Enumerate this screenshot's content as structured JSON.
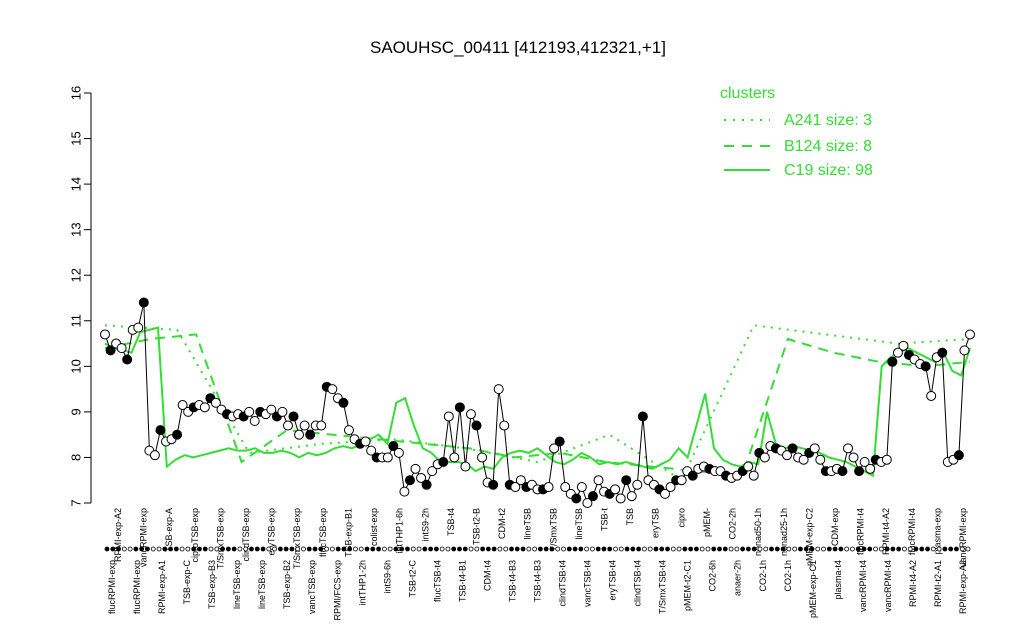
{
  "chart_data": {
    "type": "line",
    "title": "SAOUHSC_00411 [412193,412321,+1]",
    "ylim": [
      7,
      16
    ],
    "yticks": [
      7,
      8,
      9,
      10,
      11,
      12,
      13,
      14,
      15,
      16
    ],
    "legend": {
      "title": "clusters",
      "placement": "top-right",
      "color": "#33dd33",
      "entries": [
        {
          "label": "A241 size: 3",
          "style": "dotted"
        },
        {
          "label": "B124 size: 8",
          "style": "dashed"
        },
        {
          "label": "C19 size: 98",
          "style": "solid"
        }
      ]
    },
    "bottom_labels": [
      "flucRPMI-exp",
      "flucRPMI-exp",
      "RPMI-exp-A1",
      "TSB-exp-C",
      "TSB-exp-B3",
      "lineTSB-exp",
      "lineTSB-exp",
      "TSB-exp-B2",
      "vancTSB-exp",
      "RPMI/FCS-exp",
      "intTHP1-2h",
      "intS9-6h",
      "TSB-t2-C",
      "flucTSB-t4",
      "TSB-t4-B1",
      "CDM-t4",
      "TSB-t4-B3",
      "TSB-t4-B3",
      "clindTSB-t4",
      "vancTSB-t4",
      "eryTSB-t4",
      "clindTSB-t4",
      "T/SmxTSB-t4",
      "pMEM-t2-C1",
      "CO2-6h",
      "anaer-2h",
      "CO2-1h",
      "CO2-1h",
      "pMEM-exp-C1",
      "plasma-t4",
      "vancRPMI-t4",
      "vancRPMI-t4",
      "RPMI-t4-A2",
      "RPMI-t2-A1",
      "RPMI-exp-A2"
    ],
    "top_labels": [
      "RPMI-exp-A2",
      "vancRPMI-exp",
      "TSB-exp-A",
      "ciproTSB-exp",
      "T/SmxTSB-exp",
      "clindTSB-exp",
      "eryTSB-exp",
      "T/SmxTSB-exp",
      "flucTSB-exp",
      "TSB-exp-B1",
      "colist-exp",
      "intTHP1-6h",
      "intS9-2h",
      "TSB-t4",
      "TSB-t2-B",
      "CDM-t2",
      "lineTSB",
      "T/SmxTSB",
      "lineTSB",
      "TSB-t",
      "TSB",
      "eryTSB",
      "cipro",
      "pMEM-",
      "CO2-2h",
      "nonad50-1h",
      "nonad25-1h",
      "pMEM-exp-C2",
      "CDM-exp",
      "flucRPMI-t4",
      "RPMI-t4-A2",
      "flucRPMI-t4",
      "plasma-exp",
      "vancRPMI-exp"
    ],
    "series": [
      {
        "name": "C19 size: 98",
        "style": "solid",
        "values": [
          10.5,
          10.4,
          10.35,
          10.3,
          10.75,
          10.8,
          10.85,
          7.8,
          7.95,
          8.05,
          8.0,
          8.05,
          8.1,
          8.15,
          8.2,
          8.15,
          8.15,
          8.2,
          8.1,
          8.1,
          8.15,
          8.1,
          8.0,
          8.1,
          8.05,
          8.1,
          8.2,
          8.25,
          8.2,
          8.3,
          8.4,
          8.5,
          8.3,
          9.2,
          9.3,
          8.7,
          8.2,
          8.1,
          7.9,
          7.9,
          7.9,
          7.85,
          7.7,
          7.8,
          7.75,
          8.0,
          8.1,
          8.15,
          8.1,
          8.2,
          8.05,
          7.9,
          7.85,
          7.95,
          8.1,
          8.0,
          7.85,
          7.9,
          7.85,
          7.9,
          7.85,
          7.8,
          7.75,
          7.85,
          7.95,
          8.2,
          8.0,
          8.7,
          9.4,
          8.2,
          7.95,
          7.85,
          7.8,
          7.9,
          7.85,
          9.0,
          8.3,
          8.2,
          8.25,
          8.2,
          8.15,
          8.1,
          8.0,
          7.95,
          7.9,
          7.8,
          7.7,
          7.6,
          10.0,
          10.2,
          10.3,
          10.4,
          10.3,
          10.2,
          10.1,
          10.3,
          9.9,
          9.8,
          10.4
        ]
      },
      {
        "name": "B124 size: 8",
        "style": "dashed",
        "values": [
          10.4,
          10.6,
          10.7,
          7.9,
          8.6,
          8.5,
          8.4,
          8.3,
          8.2,
          8.0,
          8.1,
          7.9,
          7.8,
          7.7,
          7.6,
          10.6,
          10.3,
          10.1,
          10.0,
          10.1
        ]
      },
      {
        "name": "A241 size: 3",
        "style": "dotted",
        "values": [
          10.9,
          10.8,
          8.1,
          8.3,
          8.4,
          8.2,
          7.9,
          8.5,
          7.5,
          10.9,
          10.7,
          10.5,
          10.6
        ]
      },
      {
        "name": "samples",
        "style": "points",
        "values": [
          10.7,
          10.35,
          10.5,
          10.4,
          10.15,
          10.8,
          10.85,
          11.4,
          8.15,
          8.05,
          8.6,
          8.35,
          8.4,
          8.5,
          9.15,
          9.0,
          9.1,
          9.15,
          9.1,
          9.3,
          9.2,
          9.05,
          8.95,
          8.9,
          8.95,
          8.9,
          9.0,
          8.8,
          9.0,
          8.95,
          9.05,
          8.9,
          9.0,
          8.7,
          8.9,
          8.5,
          8.7,
          8.5,
          8.7,
          8.7,
          9.55,
          9.5,
          9.3,
          9.2,
          8.6,
          8.4,
          8.3,
          8.35,
          8.15,
          8.0,
          8.0,
          8.0,
          8.25,
          8.1,
          7.25,
          7.5,
          7.75,
          7.55,
          7.4,
          7.7,
          7.85,
          7.9,
          8.9,
          8.0,
          9.1,
          7.8,
          8.95,
          8.7,
          8.0,
          7.45,
          7.4,
          9.5,
          8.7,
          7.4,
          7.35,
          7.5,
          7.35,
          7.4,
          7.3,
          7.3,
          7.35,
          8.2,
          8.35,
          7.35,
          7.2,
          7.1,
          7.35,
          7.0,
          7.15,
          7.5,
          7.25,
          7.2,
          7.3,
          7.1,
          7.5,
          7.15,
          7.4,
          8.9,
          7.5,
          7.4,
          7.3,
          7.2,
          7.35,
          7.5,
          7.5,
          7.7,
          7.6,
          7.75,
          7.8,
          7.75,
          7.7,
          7.7,
          7.6,
          7.55,
          7.6,
          7.7,
          7.8,
          7.6,
          8.1,
          8.0,
          8.25,
          8.2,
          8.15,
          8.05,
          8.2,
          8.0,
          7.95,
          8.1,
          8.2,
          7.95,
          7.7,
          7.7,
          7.75,
          7.7,
          8.2,
          8.0,
          7.7,
          7.9,
          7.75,
          7.95,
          7.9,
          7.95,
          10.1,
          10.3,
          10.45,
          10.25,
          10.15,
          10.05,
          10.0,
          9.35,
          10.2,
          10.3,
          7.9,
          7.95,
          8.05,
          10.35,
          10.7
        ]
      }
    ]
  }
}
